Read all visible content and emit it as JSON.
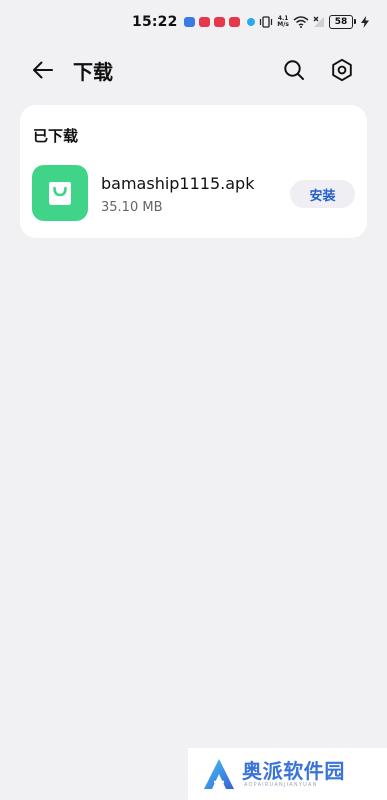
{
  "status_bar": {
    "time": "15:22",
    "netspeed": "4.1\nM/s",
    "battery": "58",
    "notification_icons": [
      "blue-app-icon",
      "red-app-icon",
      "red-app-icon",
      "red-app-icon",
      "cyan-dot-icon"
    ],
    "system_icons": [
      "vibrate-icon",
      "netspeed",
      "wifi-icon",
      "signal-off-icon",
      "battery-icon",
      "charging-icon"
    ]
  },
  "header": {
    "title": "下载",
    "back_icon": "arrow-left-icon",
    "search_icon": "search-icon",
    "settings_icon": "gear-icon"
  },
  "downloads": {
    "section_title": "已下载",
    "items": [
      {
        "file_name": "bamaship1115.apk",
        "size": "35.10 MB",
        "icon": "shopping-bag-icon",
        "action_label": "安装"
      }
    ]
  },
  "watermark": {
    "title": "奥派软件园",
    "subtitle": "AOPAIRUANJIANYUAN"
  },
  "colors": {
    "background": "#f1f1f3",
    "card": "#ffffff",
    "app_icon_bg": "#3fd487",
    "accent": "#2360c8",
    "watermark": "#3a74d8"
  }
}
